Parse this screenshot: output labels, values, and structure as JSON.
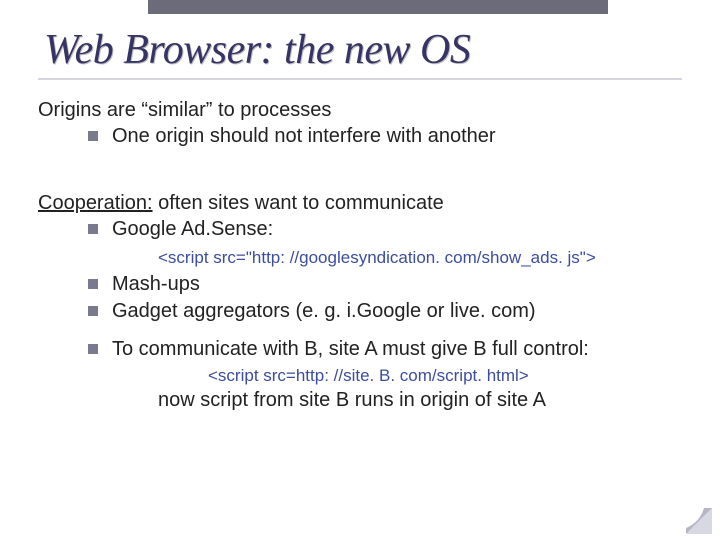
{
  "title": "Web Browser:  the new OS",
  "p1": {
    "head": "Origins are “similar” to processes",
    "b1": "One origin should not interfere with another"
  },
  "p2": {
    "label": "Cooperation:",
    "rest": "     often sites want to communicate",
    "b1": "Google Ad.Sense:",
    "code": "<script src=\"http: //googlesyndication. com/show_ads. js\">",
    "b2": "Mash-ups",
    "b3_a": "Gadget aggregators  (e. g.   ",
    "b3_b": "i.Google or live. com)",
    "b4": "To communicate with B, site A must give B full control:",
    "code2": "<script src=http: //site. B. com/script. html>",
    "closer": "now script from site B runs in origin of site A"
  }
}
